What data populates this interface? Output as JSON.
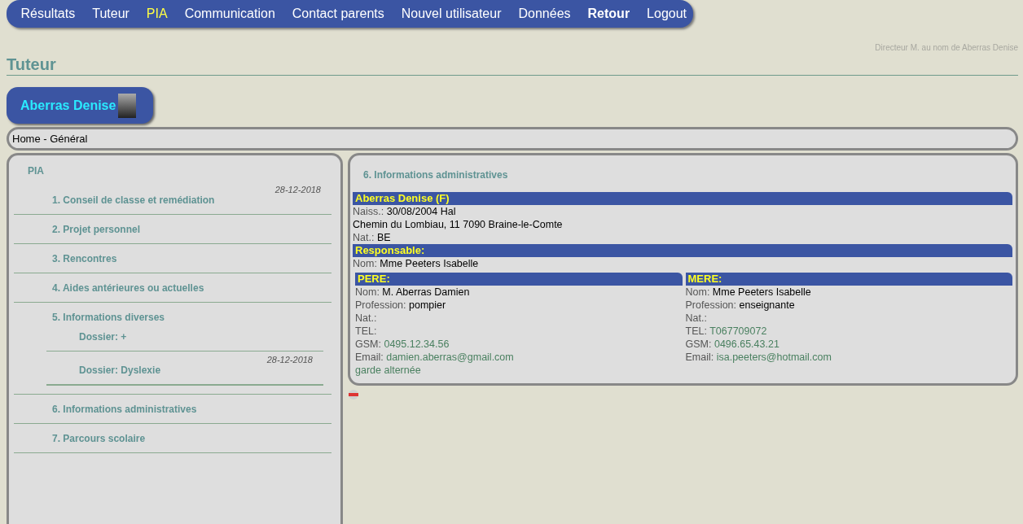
{
  "nav": [
    {
      "label": "Résultats",
      "selected": false,
      "bold": false
    },
    {
      "label": "Tuteur",
      "selected": false,
      "bold": false
    },
    {
      "label": "PIA",
      "selected": true,
      "bold": false
    },
    {
      "label": "Communication",
      "selected": false,
      "bold": false
    },
    {
      "label": "Contact parents",
      "selected": false,
      "bold": false
    },
    {
      "label": "Nouvel utilisateur",
      "selected": false,
      "bold": false
    },
    {
      "label": "Données",
      "selected": false,
      "bold": false
    },
    {
      "label": "Retour",
      "selected": false,
      "bold": true
    },
    {
      "label": "Logout",
      "selected": false,
      "bold": false
    }
  ],
  "user_info": "Directeur M. au nom de Aberras Denise",
  "page_title": "Tuteur",
  "student": {
    "name": "Aberras Denise"
  },
  "breadcrumb": "Home - Général",
  "sidebar": {
    "title": "PIA",
    "items": [
      {
        "date": "28-12-2018",
        "label": "1. Conseil de classe et remédiation"
      },
      {
        "label": "2. Projet personnel"
      },
      {
        "label": "3. Rencontres"
      },
      {
        "label": "4. Aides antérieures ou actuelles"
      },
      {
        "label": "5. Informations diverses",
        "children": [
          {
            "label": "Dossier: +"
          },
          {
            "date": "28-12-2018",
            "label": "Dossier: Dyslexie"
          }
        ]
      },
      {
        "label": "6. Informations administratives"
      },
      {
        "label": "7. Parcours scolaire"
      }
    ]
  },
  "details": {
    "title": "6. Informations administratives",
    "sections": [
      {
        "header": "Aberras Denise (F)",
        "fields": [
          {
            "label": "Naiss.:",
            "value": "30/08/2004 Hal",
            "kind": "plain"
          },
          {
            "value": "Chemin du Lombiau, 11 7090 Braine-le-Comte",
            "kind": "plain"
          },
          {
            "label": "Nat.:",
            "value": "BE",
            "kind": "plain"
          }
        ]
      },
      {
        "header": "Responsable:",
        "fields": [
          {
            "label": "Nom:",
            "value": "Mme Peeters Isabelle",
            "kind": "plain"
          }
        ]
      }
    ],
    "parents": [
      {
        "header": "PERE:",
        "fields": [
          {
            "label": "Nom:",
            "value": "M. Aberras Damien",
            "kind": "plain"
          },
          {
            "label": "Profession:",
            "value": "pompier",
            "kind": "plain"
          },
          {
            "label": "Nat.:"
          },
          {
            "label": "TEL:"
          },
          {
            "label": "GSM:",
            "value": "0495.12.34.56",
            "kind": "contact"
          },
          {
            "label": "Email:",
            "value": "damien.aberras@gmail.com",
            "kind": "contact"
          },
          {
            "value": "garde alternée",
            "kind": "contact"
          }
        ]
      },
      {
        "header": "MERE:",
        "fields": [
          {
            "label": "Nom:",
            "value": "Mme Peeters Isabelle",
            "kind": "plain"
          },
          {
            "label": "Profession:",
            "value": "enseignante",
            "kind": "plain"
          },
          {
            "label": "Nat.:"
          },
          {
            "label": "TEL:",
            "value": "T067709072",
            "kind": "contact"
          },
          {
            "label": "GSM:",
            "value": "0496.65.43.21",
            "kind": "contact"
          },
          {
            "label": "Email:",
            "value": "isa.peeters@hotmail.com",
            "kind": "contact"
          }
        ]
      }
    ]
  }
}
